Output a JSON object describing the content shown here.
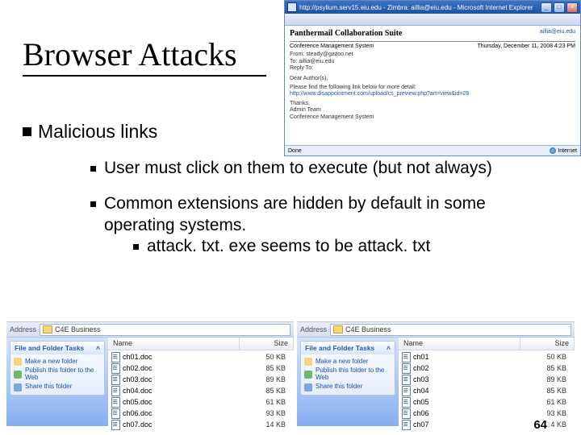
{
  "title": "Browser Attacks",
  "main_bullet": "Malicious links",
  "subs": [
    "User must click on them to execute (but not always)",
    "Common extensions are hidden by default in some operating systems."
  ],
  "sub2": "attack. txt. exe seems to be attack. txt",
  "ie": {
    "titlebar": "http://psylium.serv15.eiu.edu - Zimbra: aillia@eiu.edu - Microsoft Internet Explorer",
    "suite": "Panthermail Collaboration Suite",
    "userEmail": "aillia@eiu.edu",
    "subject": "Conference Management System",
    "date": "Thursday, December 11, 2008 4:23 PM",
    "from": "From: steady@gazoo.net",
    "to": "To: aillia@eiu.edu",
    "reply": "Reply To:",
    "salutation": "Dear Author(s),",
    "bodyLine": "Please find the following link below for more detail:",
    "link": "http://www.disappointment.com/upload/cs_preview.php?art=view&id=28",
    "sig1": "Thanks,",
    "sig2": "Admin Team",
    "sig3": "Conference Management System",
    "statusLeft": "Done",
    "statusRight": "Internet"
  },
  "exp1": {
    "addrLabel": "Address",
    "path": "C4E Business",
    "tasksHead": "File and Folder Tasks",
    "tasks": [
      "Make a new folder",
      "Publish this folder to the Web",
      "Share this folder"
    ],
    "colName": "Name",
    "colSize": "Size",
    "files": [
      {
        "n": "ch01.doc",
        "s": "50 KB"
      },
      {
        "n": "ch02.doc",
        "s": "85 KB"
      },
      {
        "n": "ch03.doc",
        "s": "89 KB"
      },
      {
        "n": "ch04.doc",
        "s": "85 KB"
      },
      {
        "n": "ch05.doc",
        "s": "61 KB"
      },
      {
        "n": "ch06.doc",
        "s": "93 KB"
      },
      {
        "n": "ch07.doc",
        "s": "14 KB"
      }
    ]
  },
  "exp2": {
    "addrLabel": "Address",
    "path": "C4E Business",
    "tasksHead": "File and Folder Tasks",
    "tasks": [
      "Make a new folder",
      "Publish this folder to the Web",
      "Share this folder"
    ],
    "colName": "Name",
    "colSize": "Size",
    "files": [
      {
        "n": "ch01",
        "s": "50 KB"
      },
      {
        "n": "ch02",
        "s": "85 KB"
      },
      {
        "n": "ch03",
        "s": "89 KB"
      },
      {
        "n": "ch04",
        "s": "85 KB"
      },
      {
        "n": "ch05",
        "s": "61 KB"
      },
      {
        "n": "ch06",
        "s": "93 KB"
      },
      {
        "n": "ch07",
        "s": "14 KB"
      }
    ]
  },
  "pageNum": "64"
}
